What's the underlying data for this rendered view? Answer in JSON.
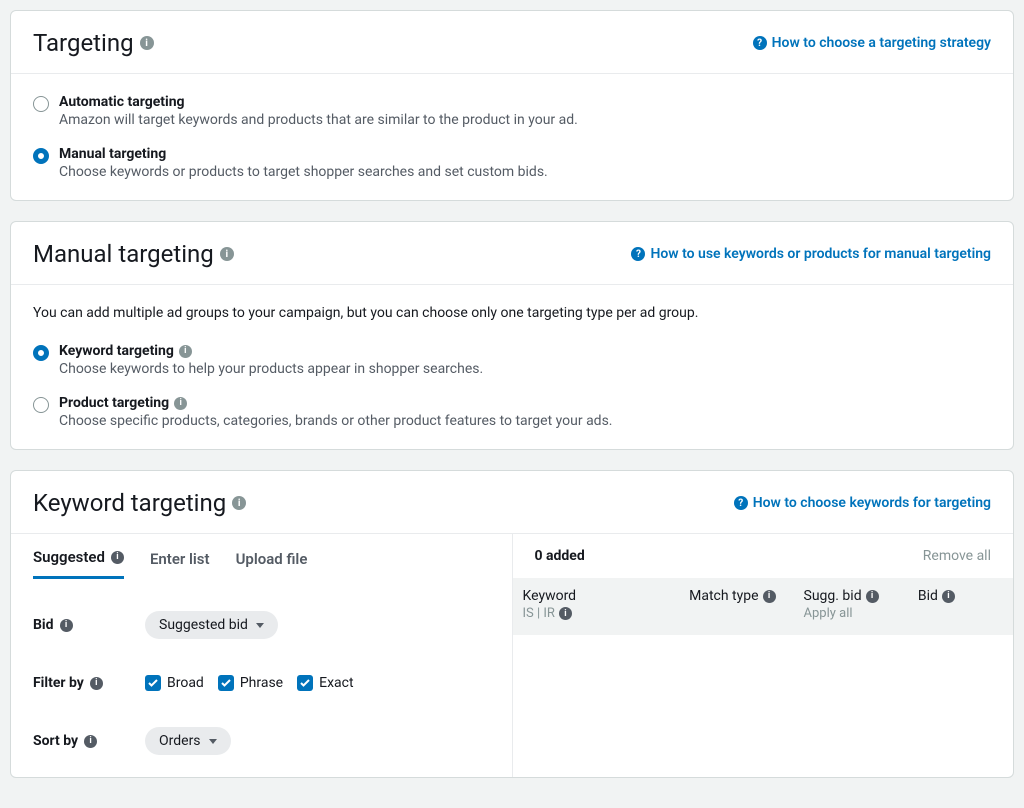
{
  "targeting": {
    "title": "Targeting",
    "help_link": "How to choose a targeting strategy",
    "options": {
      "auto": {
        "label": "Automatic targeting",
        "desc": "Amazon will target keywords and products that are similar to the product in your ad."
      },
      "manual": {
        "label": "Manual targeting",
        "desc": "Choose keywords or products to target shopper searches and set custom bids."
      }
    }
  },
  "manual": {
    "title": "Manual targeting",
    "help_link": "How to use keywords or products for manual targeting",
    "intro": "You can add multiple ad groups to your campaign, but you can choose only one targeting type per ad group.",
    "options": {
      "keyword": {
        "label": "Keyword targeting",
        "desc": "Choose keywords to help your products appear in shopper searches."
      },
      "product": {
        "label": "Product targeting",
        "desc": "Choose specific products, categories, brands or other product features to target your ads."
      }
    }
  },
  "keyword": {
    "title": "Keyword targeting",
    "help_link": "How to choose keywords for targeting",
    "tabs": {
      "suggested": "Suggested",
      "enter_list": "Enter list",
      "upload_file": "Upload file"
    },
    "controls": {
      "bid_label": "Bid",
      "bid_value": "Suggested bid",
      "filter_label": "Filter by",
      "filter_broad": "Broad",
      "filter_phrase": "Phrase",
      "filter_exact": "Exact",
      "sort_label": "Sort by",
      "sort_value": "Orders"
    },
    "right": {
      "added": "0 added",
      "remove_all": "Remove all",
      "col_keyword": "Keyword",
      "col_keyword_sub": "IS | IR",
      "col_match": "Match type",
      "col_sugg": "Sugg. bid",
      "col_sugg_sub": "Apply all",
      "col_bid": "Bid"
    }
  },
  "icons": {
    "info": "i",
    "help": "?"
  }
}
